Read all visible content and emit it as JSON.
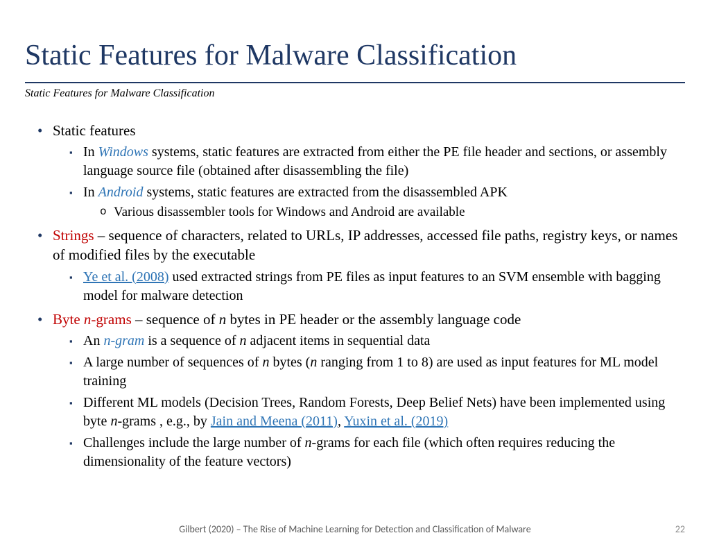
{
  "title": "Static Features for Malware Classification",
  "subtitle": "Static Features for Malware Classification",
  "bullets": {
    "b1": "Static features",
    "b1a_pre": "In ",
    "b1a_windows": "Windows",
    "b1a_post": " systems, static features are extracted from either the PE file header and sections, or assembly language source file (obtained after disassembling the file)",
    "b1b_pre": "In ",
    "b1b_android": "Android",
    "b1b_post": " systems, static features are extracted from the disassembled APK",
    "b1b_sub": "Various disassembler tools for Windows and Android are available",
    "b2_strings": "Strings",
    "b2_post": " – sequence of characters, related to URLs, IP addresses, accessed file paths, registry keys, or names of modified files by the executable",
    "b2a_link": "Ye et al. (2008)",
    "b2a_post": " used extracted strings from PE files as input features to an SVM ensemble with bagging model for malware detection",
    "b3_byte": "Byte ",
    "b3_n": "n",
    "b3_grams": "-grams",
    "b3_post": " – sequence of ",
    "b3_n2": "n",
    "b3_post2": " bytes in PE header or the assembly language code",
    "b3a_pre": "An ",
    "b3a_ngram": "n-gram",
    "b3a_post": " is a sequence of ",
    "b3a_n": "n",
    "b3a_post2": " adjacent items in sequential data",
    "b3b_pre": "A large number of sequences of ",
    "b3b_n": "n",
    "b3b_mid": " bytes (",
    "b3b_n2": "n",
    "b3b_post": " ranging from 1 to 8) are used as input features for ML model training",
    "b3c_pre": "Different ML models (Decision Trees, Random Forests, Deep Belief Nets) have been implemented using byte ",
    "b3c_n": "n",
    "b3c_mid": "-grams , e.g., by ",
    "b3c_link1": "Jain and Meena (2011)",
    "b3c_sep": ", ",
    "b3c_link2": "Yuxin et al. (2019)",
    "b3d_pre": "Challenges include the large number of ",
    "b3d_n": "n",
    "b3d_post": "-grams for each file (which often requires reducing the dimensionality of the feature vectors)"
  },
  "footer": "Gilbert (2020) – The Rise of Machine Learning for Detection and Classification of Malware",
  "pagenum": "22"
}
